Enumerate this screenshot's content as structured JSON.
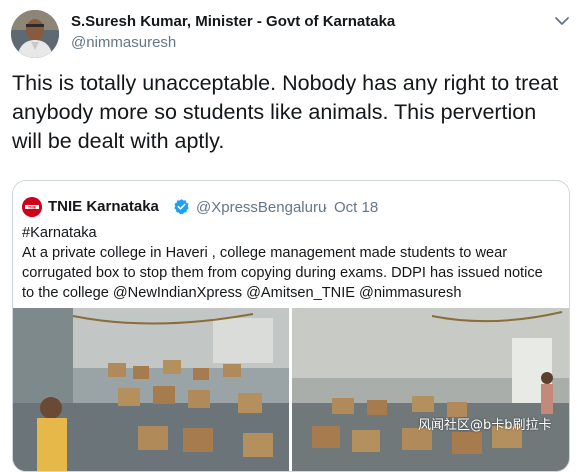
{
  "author": {
    "name": "S.Suresh Kumar, Minister - Govt of Karnataka",
    "handle": "@nimmasuresh",
    "avatar_icon": "profile-photo"
  },
  "tweet": {
    "lines": [
      "This is totally unacceptable. Nobody has any right to treat",
      "anybody more so students like animals. This pervertion",
      "will be dealt with aptly."
    ]
  },
  "quoted": {
    "name": "TNIE Karnataka",
    "verified_icon": "verified-badge-icon",
    "handle": "@XpressBengaluru",
    "separator": "·",
    "date": "Oct 18",
    "text_lines": [
      "#Karnataka",
      "At a private college in Haveri , college management made students to wear",
      "corrugated box to stop them from copying during exams. DDPI has issued notice",
      "to the college @NewIndianXpress @Amitsen_TNIE @nimmasuresh"
    ],
    "logo_text": "TNIE"
  },
  "watermark": "风闻社区@b卡b刷拉卡",
  "colors": {
    "text": "#14171a",
    "secondary": "#657786",
    "border": "#ccd6dd",
    "verified": "#1da1f2",
    "logo_red": "#d0021b",
    "cardboard": "#b08a5a"
  }
}
